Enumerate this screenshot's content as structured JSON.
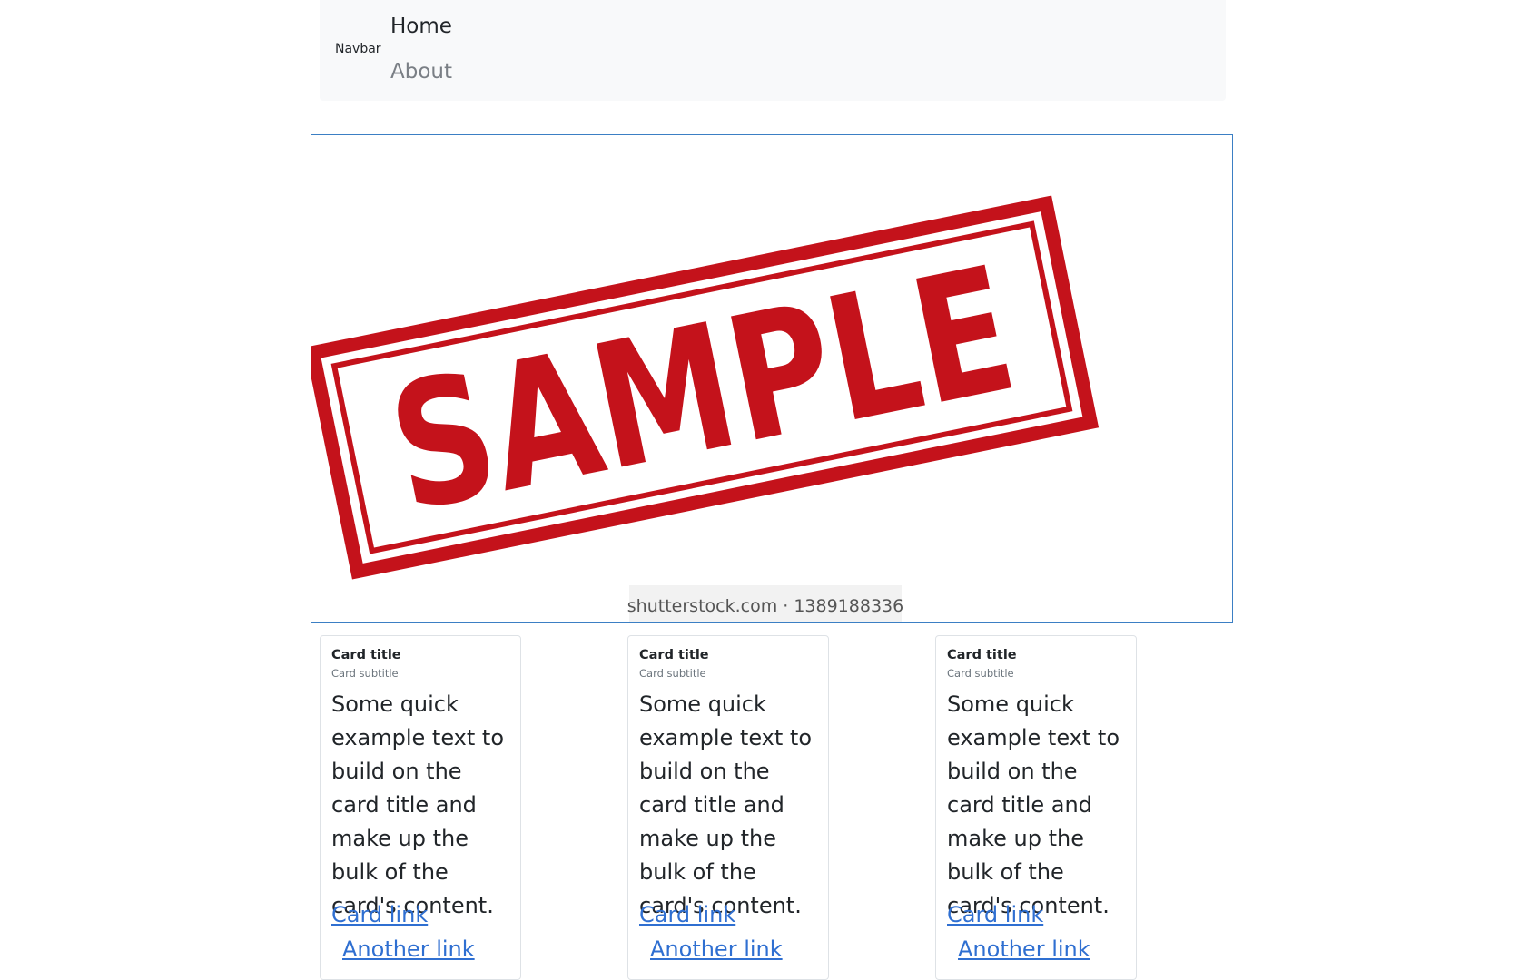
{
  "navbar": {
    "brand": "Navbar",
    "links": [
      {
        "label": "Home",
        "active": true
      },
      {
        "label": "About",
        "active": false
      }
    ]
  },
  "hero": {
    "stamp_text": "SAMPLE",
    "watermark": "shutterstock.com · 1389188336",
    "stamp_color": "#c4121b",
    "frame_color": "#3b7fc4"
  },
  "cards": [
    {
      "title": "Card title",
      "subtitle": "Card subtitle",
      "text": "Some quick example text to build on the card title and make up the bulk of the card's content.",
      "link1": "Card link",
      "link2": "Another link"
    },
    {
      "title": "Card title",
      "subtitle": "Card subtitle",
      "text": "Some quick example text to build on the card title and make up the bulk of the card's content.",
      "link1": "Card link",
      "link2": "Another link"
    },
    {
      "title": "Card title",
      "subtitle": "Card subtitle",
      "text": "Some quick example text to build on the card title and make up the bulk of the card's content.",
      "link1": "Card link",
      "link2": "Another link"
    }
  ],
  "colors": {
    "navbar_bg": "#f8f9fa",
    "link": "#2f6fd1",
    "muted": "#6c757d"
  }
}
